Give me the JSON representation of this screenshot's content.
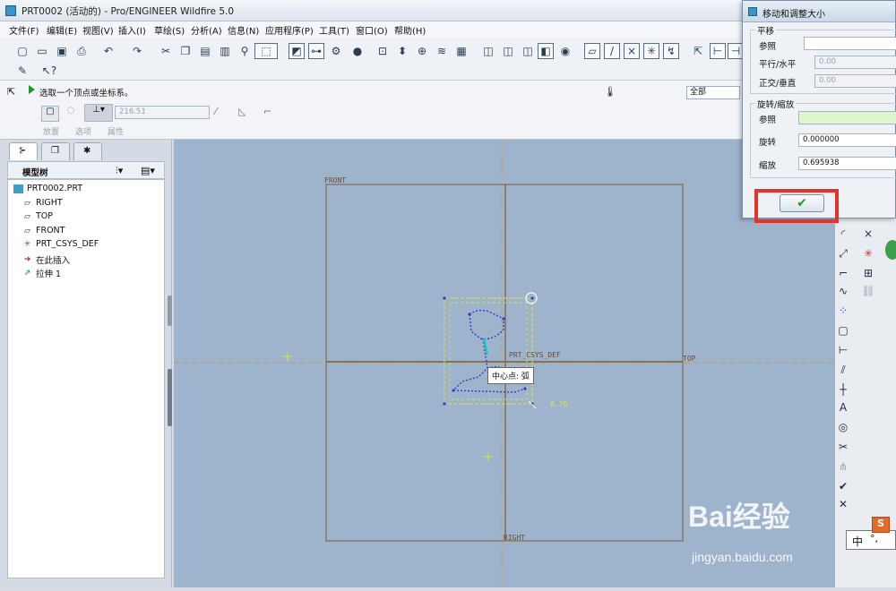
{
  "window": {
    "title": "PRT0002 (活动的) - Pro/ENGINEER Wildfire 5.0"
  },
  "menu": [
    "文件(F)",
    "编辑(E)",
    "视图(V)",
    "插入(I)",
    "草绘(S)",
    "分析(A)",
    "信息(N)",
    "应用程序(P)",
    "工具(T)",
    "窗口(O)",
    "帮助(H)"
  ],
  "dashboard": {
    "message": "选取一个顶点或坐标系。",
    "filter": "全部",
    "value_field": "216.51",
    "tabs": [
      "放置",
      "选项",
      "属性"
    ]
  },
  "model_tree": {
    "title": "模型树",
    "items": [
      "PRT0002.PRT",
      "RIGHT",
      "TOP",
      "FRONT",
      "PRT_CSYS_DEF",
      "在此插入",
      "拉伸 1"
    ]
  },
  "canvas": {
    "labels": {
      "front": "FRONT",
      "top": "TOP",
      "right": "RIGHT",
      "csys": "PRT_CSYS_DEF",
      "dim": "0.70"
    },
    "tooltip": "中心点: 弧"
  },
  "dialog": {
    "title": "移动和调整大小",
    "translate_group": "平移",
    "ref_label": "参照",
    "horizontal_label": "平行/水平",
    "horizontal_value": "0.00",
    "vertical_label": "正交/垂直",
    "vertical_value": "0.00",
    "rotate_group": "旋转/缩放",
    "ref2_label": "参照",
    "rotate_label": "旋转",
    "rotate_value": "0.000000",
    "scale_label": "缩放",
    "scale_value": "0.695938"
  },
  "watermark": {
    "brand": "Bai经验",
    "url": "jingyan.baidu.com"
  },
  "ime": {
    "text": "中"
  },
  "colors": {
    "canvas": "#9eb4cd",
    "datum": "#7a5a3a",
    "highlight": "#e0342e",
    "ok_check": "#18a12a"
  }
}
